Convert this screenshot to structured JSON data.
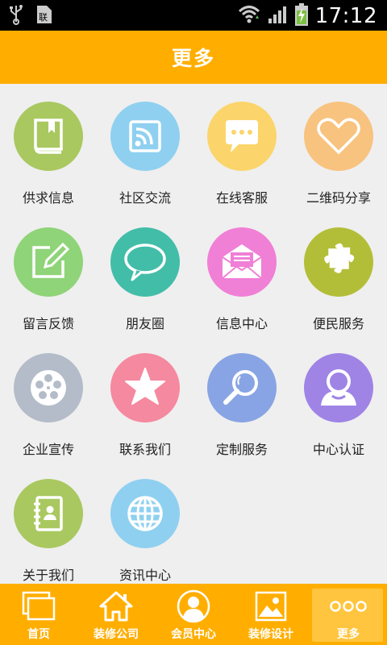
{
  "status_bar": {
    "time": "17:12",
    "icons": [
      "usb-icon",
      "sim-card-icon",
      "wifi-icon",
      "signal-icon",
      "battery-charging-icon"
    ]
  },
  "header": {
    "title": "更多"
  },
  "grid": {
    "items": [
      {
        "label": "供求信息",
        "icon": "book-icon",
        "color": "#a9c860"
      },
      {
        "label": "社区交流",
        "icon": "rss-icon",
        "color": "#8fd0f0"
      },
      {
        "label": "在线客服",
        "icon": "chat-bubble-icon",
        "color": "#fbd56b"
      },
      {
        "label": "二维码分享",
        "icon": "heart-icon",
        "color": "#f8c37f"
      },
      {
        "label": "留言反馈",
        "icon": "edit-note-icon",
        "color": "#8fd478"
      },
      {
        "label": "朋友圈",
        "icon": "speech-bubble-icon",
        "color": "#42bda8"
      },
      {
        "label": "信息中心",
        "icon": "envelope-icon",
        "color": "#f07fd6"
      },
      {
        "label": "便民服务",
        "icon": "puzzle-icon",
        "color": "#b3be38"
      },
      {
        "label": "企业宣传",
        "icon": "film-reel-icon",
        "color": "#b3bcc8"
      },
      {
        "label": "联系我们",
        "icon": "star-icon",
        "color": "#f5899f"
      },
      {
        "label": "定制服务",
        "icon": "magnifier-icon",
        "color": "#88a4e4"
      },
      {
        "label": "中心认证",
        "icon": "user-icon",
        "color": "#9f84e6"
      },
      {
        "label": "关于我们",
        "icon": "contact-book-icon",
        "color": "#a9c860"
      },
      {
        "label": "资讯中心",
        "icon": "globe-icon",
        "color": "#8fd0f0"
      }
    ]
  },
  "bottom_nav": {
    "items": [
      {
        "label": "首页",
        "icon": "home-screens-icon"
      },
      {
        "label": "装修公司",
        "icon": "house-icon"
      },
      {
        "label": "会员中心",
        "icon": "member-avatar-icon"
      },
      {
        "label": "装修设计",
        "icon": "picture-icon"
      },
      {
        "label": "更多",
        "icon": "more-dots-icon",
        "active": true
      }
    ]
  }
}
